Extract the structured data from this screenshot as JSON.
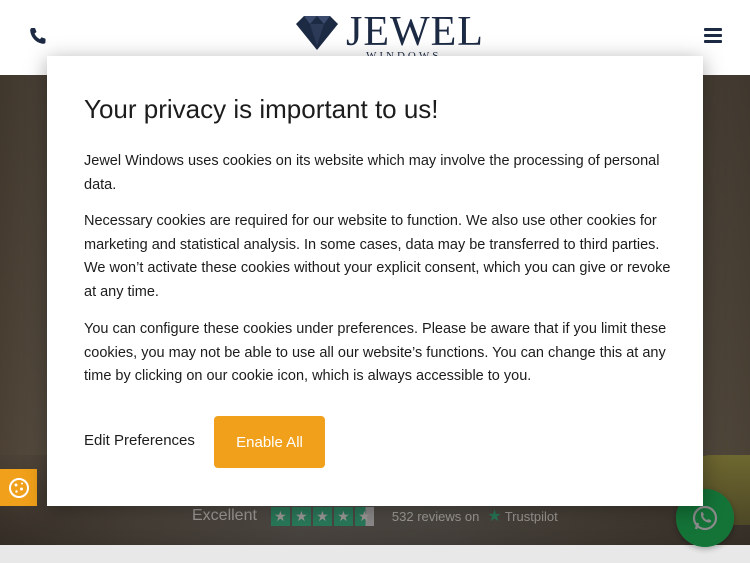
{
  "header": {
    "phone_icon": "phone-icon",
    "menu_icon": "hamburger-menu-icon",
    "logo": {
      "title": "JEWEL",
      "subtitle": "WINDOWS"
    }
  },
  "trustpilot": {
    "rating_word": "Excellent",
    "stars": 4.5,
    "reviews_text": "532 reviews on",
    "brand": "Trustpilot"
  },
  "modal": {
    "title": "Your privacy is important to us!",
    "paragraph_1": "Jewel Windows uses cookies on its website which may involve the processing of personal data.",
    "paragraph_2": "Necessary cookies are required for our website to function. We also use other cookies for marketing and statistical analysis. In some cases, data may be transferred to third parties. We won’t activate these cookies without your explicit consent, which you can give or revoke at any time.",
    "paragraph_3": "You can configure these cookies under preferences. Please be aware that if you limit these cookies, you may not be able to use all our website’s functions. You can change this at any time by clicking on our cookie icon, which is always accessible to you.",
    "edit_preferences_label": "Edit Preferences",
    "enable_all_label": "Enable All"
  },
  "colors": {
    "accent": "#f0a01a",
    "brand_navy": "#1d2a44",
    "whatsapp": "#25d366",
    "trustpilot_green": "#00b67a"
  }
}
